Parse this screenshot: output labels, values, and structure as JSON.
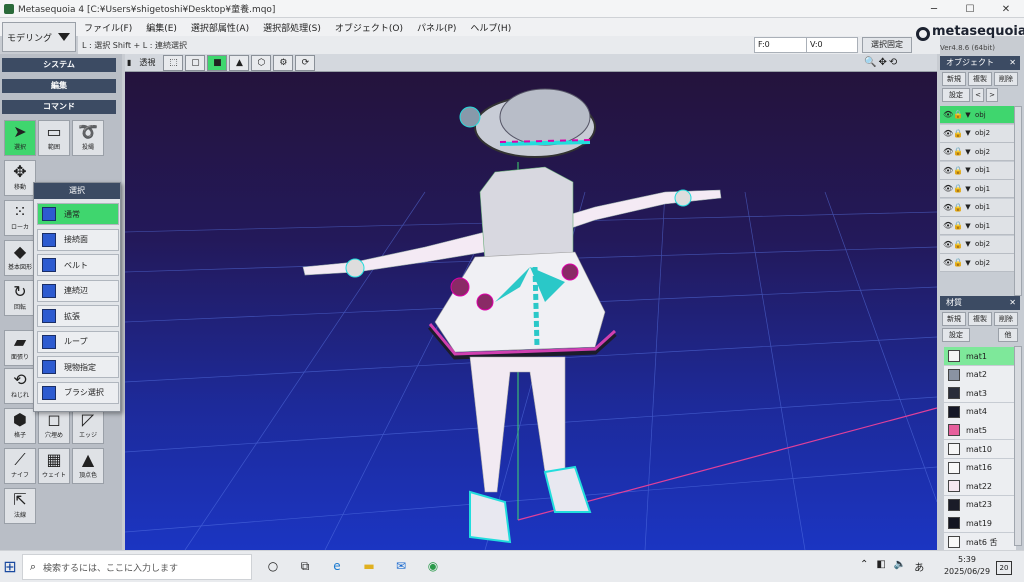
{
  "window": {
    "title": "Metasequoia 4 [C:¥Users¥shigetoshi¥Desktop¥童養.mqo]",
    "controls": [
      "─",
      "☐",
      "✕"
    ]
  },
  "mode_select": {
    "value": "モデリング"
  },
  "menu": [
    "ファイル(F)",
    "編集(E)",
    "選択部属性(A)",
    "選択部処理(S)",
    "オブジェクト(O)",
    "パネル(P)",
    "ヘルプ(H)"
  ],
  "hint": "L : 選択  Shift + L : 連続選択",
  "status": {
    "f_value": "F:0",
    "v_value": "V:0",
    "select_fix": "選択固定"
  },
  "brand": {
    "name": "metasequoia4",
    "version": "Ver4.8.6 (64bit)"
  },
  "viewport_toolbar": {
    "perspective": "透視"
  },
  "left_panel": {
    "system": "システム",
    "edit": "編集",
    "command": "コマンド",
    "tools": [
      {
        "label": "選択",
        "icon": "arrow-cursor-icon"
      },
      {
        "label": "範囲",
        "icon": "rect-select-icon"
      },
      {
        "label": "投縄",
        "icon": "lasso-icon"
      },
      {
        "label": "移動",
        "icon": "move-icon"
      },
      {
        "label": "ローカ",
        "icon": "local-icon"
      },
      {
        "label": "基本図形",
        "icon": "primitive-icon"
      },
      {
        "label": "回転",
        "icon": "rotate-icon"
      },
      {
        "label": "面張り",
        "icon": "face-icon"
      },
      {
        "label": "ねじれ",
        "icon": "twist-icon"
      },
      {
        "label": "格子",
        "icon": "lattice-icon"
      },
      {
        "label": "穴埋め",
        "icon": "fill-hole-icon"
      },
      {
        "label": "エッジ",
        "icon": "edge-icon"
      },
      {
        "label": "ナイフ",
        "icon": "knife-icon"
      },
      {
        "label": "ウェイト",
        "icon": "weight-icon"
      },
      {
        "label": "頂点色",
        "icon": "vertex-color-icon"
      },
      {
        "label": "法線",
        "icon": "normal-icon"
      }
    ]
  },
  "select_popup": {
    "title": "選択",
    "items": [
      "通常",
      "接続面",
      "ベルト",
      "連続辺",
      "拡張",
      "ループ",
      "現物指定",
      "ブラシ選択"
    ]
  },
  "object_panel": {
    "title": "オブジェクト",
    "buttons": [
      "新規",
      "複製",
      "削除",
      "設定",
      "<",
      ">"
    ],
    "objects": [
      "obj",
      "obj2",
      "obj2",
      "obj1",
      "obj1",
      "obj1",
      "obj1",
      "obj2",
      "obj2"
    ]
  },
  "material_panel": {
    "title": "材質",
    "buttons": [
      "新規",
      "複製",
      "削除",
      "設定",
      "他"
    ],
    "materials": [
      {
        "name": "mat1",
        "color": "#f4f4f4"
      },
      {
        "name": "mat2",
        "color": "#8a93a2"
      },
      {
        "name": "mat3",
        "color": "#2a2d3a"
      },
      {
        "name": "mat4",
        "color": "#151726"
      },
      {
        "name": "mat5",
        "color": "#e65f9c"
      },
      {
        "name": "mat10",
        "color": "#f6f6f6"
      },
      {
        "name": "mat16",
        "color": "#f8f8f8"
      },
      {
        "name": "mat22",
        "color": "#f6e8f0"
      },
      {
        "name": "mat23",
        "color": "#1a1c28"
      },
      {
        "name": "mat19",
        "color": "#121420"
      },
      {
        "name": "mat6 舌",
        "color": "#f8f8f8"
      }
    ]
  },
  "taskbar": {
    "search_placeholder": "検索するには、ここに入力します",
    "time": "5:39",
    "date": "2025/06/29",
    "notifications": "20"
  },
  "colors": {
    "accent": "#3fd66e",
    "header": "#3c4b63",
    "viewport_top": "#24133c",
    "viewport_bottom": "#1b35c2"
  }
}
